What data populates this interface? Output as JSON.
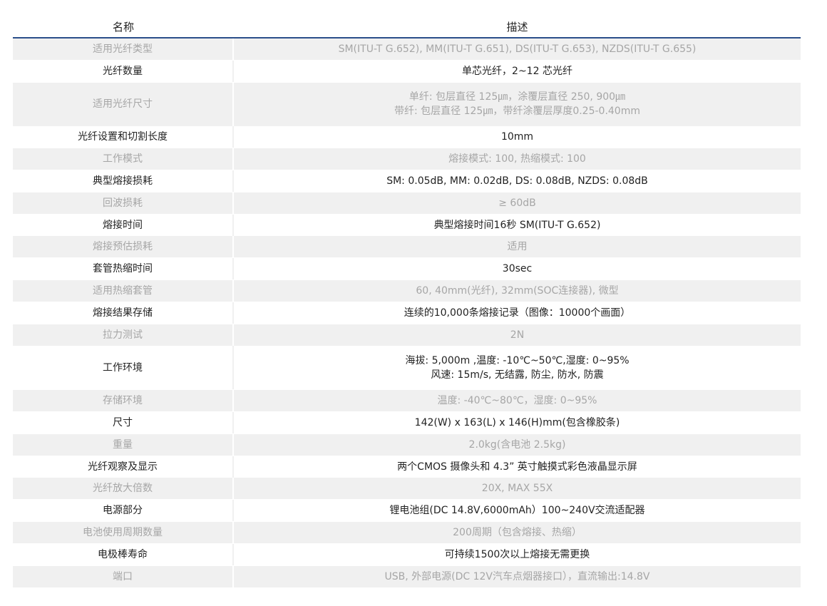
{
  "header": {
    "name_label": "名称",
    "desc_label": "描述"
  },
  "colors": {
    "header_rule": "#2b4f8a",
    "shaded_row": "#f0f0f0",
    "shaded_text": "#a6a6a6",
    "plain_text": "#222222"
  },
  "rows": [
    {
      "name": "适用光纤类型",
      "desc": [
        "SM(ITU-T G.652), MM(ITU-T G.651), DS(ITU-T G.653), NZDS(ITU-T G.655)"
      ]
    },
    {
      "name": "光纤数量",
      "desc": [
        "单芯光纤，2~12 芯光纤"
      ]
    },
    {
      "name": "适用光纤尺寸",
      "desc": [
        "单纤: 包层直径 125㎛，涂覆层直径 250, 900㎛",
        "带纤: 包层直径 125㎛，带纤涂覆层厚度0.25-0.40mm"
      ]
    },
    {
      "name": "光纤设置和切割长度",
      "desc": [
        "10mm"
      ]
    },
    {
      "name": "工作模式",
      "desc": [
        "熔接模式: 100, 热缩模式: 100"
      ]
    },
    {
      "name": "典型熔接损耗",
      "desc": [
        "SM: 0.05dB, MM: 0.02dB, DS: 0.08dB, NZDS: 0.08dB"
      ]
    },
    {
      "name": "回波损耗",
      "desc": [
        "≥ 60dB"
      ]
    },
    {
      "name": "熔接时间",
      "desc": [
        "典型熔接时间16秒 SM(ITU-T G.652)"
      ]
    },
    {
      "name": "熔接预估损耗",
      "desc": [
        "适用"
      ]
    },
    {
      "name": "套管热缩时间",
      "desc": [
        "30sec"
      ]
    },
    {
      "name": "适用热缩套管",
      "desc": [
        "60, 40mm(光纤), 32mm(SOC连接器), 微型"
      ]
    },
    {
      "name": "熔接结果存储",
      "desc": [
        "连续的10,000条熔接记录（图像：10000个画面）"
      ]
    },
    {
      "name": "拉力测试",
      "desc": [
        "2N"
      ]
    },
    {
      "name": "工作环境",
      "desc": [
        "海拔: 5,000m ,温度: -10℃~50℃,湿度: 0~95%",
        "风速: 15m/s, 无结露, 防尘, 防水, 防震"
      ]
    },
    {
      "name": "存储环境",
      "desc": [
        "温度: -40℃~80℃，湿度: 0~95%"
      ]
    },
    {
      "name": "尺寸",
      "desc": [
        "142(W) x 163(L) x 146(H)mm(包含橡胶条)"
      ]
    },
    {
      "name": "重量",
      "desc": [
        "2.0kg(含电池 2.5kg)"
      ]
    },
    {
      "name": "光纤观察及显示",
      "desc": [
        "两个CMOS 摄像头和 4.3” 英寸触摸式彩色液晶显示屏"
      ]
    },
    {
      "name": "光纤放大倍数",
      "desc": [
        "20X, MAX 55X"
      ]
    },
    {
      "name": "电源部分",
      "desc": [
        "锂电池组(DC 14.8V,6000mAh）100~240V交流适配器"
      ]
    },
    {
      "name": "电池使用周期数量",
      "desc": [
        "200周期（包含熔接、热缩）"
      ]
    },
    {
      "name": "电极棒寿命",
      "desc": [
        "可持续1500次以上熔接无需更换"
      ]
    },
    {
      "name": "端口",
      "desc": [
        "USB, 外部电源(DC 12V汽车点烟器接口），直流输出:14.8V"
      ]
    }
  ]
}
